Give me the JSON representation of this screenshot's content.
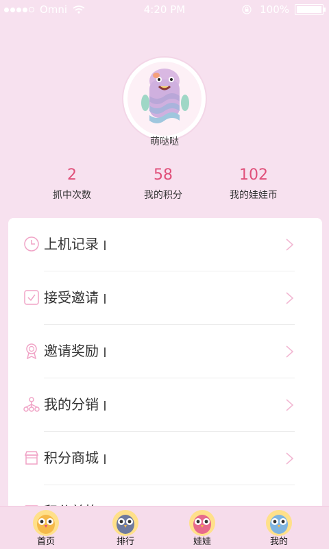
{
  "status_bar": {
    "carrier": "Omni",
    "time": "4:20 PM",
    "battery": "100%",
    "signal_dots": 4
  },
  "profile": {
    "nickname": "萌哒哒",
    "avatar": "pink-jellyfish-mascot"
  },
  "stats": [
    {
      "value": "2",
      "label": "抓中次数"
    },
    {
      "value": "58",
      "label": "我的积分"
    },
    {
      "value": "102",
      "label": "我的娃娃币"
    }
  ],
  "menu": {
    "items": [
      {
        "label": "上机记录",
        "icon": "clock-icon"
      },
      {
        "label": "接受邀请",
        "icon": "checkbox-icon"
      },
      {
        "label": "邀请奖励",
        "icon": "award-medal-icon"
      },
      {
        "label": "我的分销",
        "icon": "network-tree-icon"
      },
      {
        "label": "积分商城",
        "icon": "store-icon"
      },
      {
        "label": "积分兑换",
        "icon": "exchange-icon"
      }
    ]
  },
  "tabbar": {
    "items": [
      {
        "label": "首页",
        "icon": "owl-yellow-icon"
      },
      {
        "label": "排行",
        "icon": "owl-gray-icon"
      },
      {
        "label": "娃娃",
        "icon": "owl-pink-icon"
      },
      {
        "label": "我的",
        "icon": "owl-blue-icon"
      }
    ]
  },
  "colors": {
    "background": "#f7e1ef",
    "accent": "#e0507a",
    "tabbar": "#f6dceb",
    "icon_pink": "#f0a3c6"
  }
}
